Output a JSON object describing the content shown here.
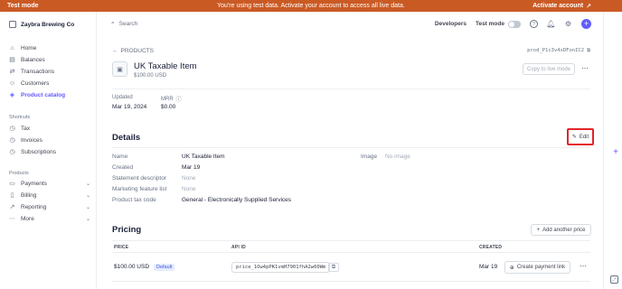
{
  "banner": {
    "left": "Test mode",
    "message": "You're using test data. Activate your account to access all live data.",
    "action": "Activate account"
  },
  "sidebar": {
    "account_name": "Zaybra Brewing Co",
    "items": [
      {
        "label": "Home",
        "icon": "home-icon"
      },
      {
        "label": "Balances",
        "icon": "balances-icon"
      },
      {
        "label": "Transactions",
        "icon": "transactions-icon"
      },
      {
        "label": "Customers",
        "icon": "customers-icon"
      },
      {
        "label": "Product catalog",
        "icon": "product-catalog-icon",
        "active": true
      }
    ],
    "shortcuts_title": "Shortcuts",
    "shortcuts": [
      {
        "label": "Tax"
      },
      {
        "label": "Invoices"
      },
      {
        "label": "Subscriptions"
      }
    ],
    "products_title": "Products",
    "products": [
      {
        "label": "Payments"
      },
      {
        "label": "Billing"
      },
      {
        "label": "Reporting"
      },
      {
        "label": "More"
      }
    ]
  },
  "topbar": {
    "search_placeholder": "Search",
    "developers": "Developers",
    "test_mode": "Test mode"
  },
  "product": {
    "breadcrumb": "PRODUCTS",
    "id": "prod_P1c3v4sDFonIC2",
    "name": "UK Taxable Item",
    "price": "$100.00 USD",
    "copy_live_label": "Copy to live mode",
    "updated_label": "Updated",
    "updated_value": "Mar 19, 2024",
    "mrr_label": "MRR",
    "mrr_value": "$0.00"
  },
  "details": {
    "title": "Details",
    "edit_label": "Edit",
    "name_label": "Name",
    "name_value": "UK Taxable Item",
    "created_label": "Created",
    "created_value": "Mar 19",
    "statement_label": "Statement descriptor",
    "statement_value": "None",
    "marketing_label": "Marketing feature list",
    "marketing_value": "None",
    "tax_code_label": "Product tax code",
    "tax_code_value": "General - Electronically Supplied Services",
    "image_label": "Image",
    "image_value": "No image"
  },
  "pricing": {
    "title": "Pricing",
    "add_price_label": "Add another price",
    "columns": {
      "price": "PRICE",
      "api_id": "API ID",
      "created": "CREATED"
    },
    "rows": [
      {
        "price": "$100.00 USD",
        "badge": "Default",
        "api_id": "price_1Ow4pPK1vmH7901fhA2w60Wm",
        "created": "Mar 19",
        "action": "Create payment link"
      }
    ]
  }
}
